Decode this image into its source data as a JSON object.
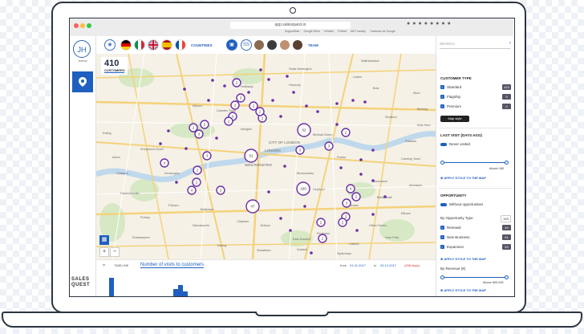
{
  "browser": {
    "address": "app.salesquest.io",
    "bookmarks": [
      "SupportBee",
      "Google Drive",
      "InVision",
      "Pocket",
      "MKT weekly",
      "Traductor de Google"
    ]
  },
  "nav": {
    "avatar_initials": "JH",
    "user_name": "Jeremy",
    "brand_line1": "SALES",
    "brand_line2": "QUEST"
  },
  "topbar": {
    "countries_label": "COUNTRIES",
    "team_label": "TEAM",
    "team_count_badge": "SS",
    "flags": [
      "germany",
      "italy",
      "united-kingdom",
      "spain",
      "france"
    ]
  },
  "map": {
    "customer_count": "410",
    "customer_label": "CUSTOMERS",
    "clusters": [
      {
        "label": "2",
        "kind": "small"
      },
      {
        "label": "3",
        "kind": "small"
      },
      {
        "label": "2",
        "kind": "small"
      },
      {
        "label": "2",
        "kind": "small"
      },
      {
        "label": "3",
        "kind": "small"
      },
      {
        "label": "2",
        "kind": "small"
      },
      {
        "label": "2",
        "kind": "small"
      },
      {
        "label": "2",
        "kind": "small"
      },
      {
        "label": "3",
        "kind": "small"
      },
      {
        "label": "2",
        "kind": "small"
      },
      {
        "label": "2",
        "kind": "small"
      },
      {
        "label": "52",
        "kind": "big"
      },
      {
        "label": "3",
        "kind": "small"
      },
      {
        "label": "2",
        "kind": "small"
      },
      {
        "label": "3",
        "kind": "small"
      },
      {
        "label": "51",
        "kind": "big"
      },
      {
        "label": "4",
        "kind": "small"
      },
      {
        "label": "3",
        "kind": "small"
      },
      {
        "label": "2",
        "kind": "small"
      },
      {
        "label": "2",
        "kind": "small"
      },
      {
        "label": "4",
        "kind": "small"
      },
      {
        "label": "2",
        "kind": "small"
      },
      {
        "label": "100",
        "kind": "big"
      },
      {
        "label": "4",
        "kind": "small"
      },
      {
        "label": "47",
        "kind": "big"
      },
      {
        "label": "2",
        "kind": "small"
      },
      {
        "label": "3",
        "kind": "small"
      },
      {
        "label": "3",
        "kind": "small"
      },
      {
        "label": "2",
        "kind": "small"
      },
      {
        "label": "2",
        "kind": "small"
      },
      {
        "label": "2",
        "kind": "small"
      }
    ],
    "place_labels": [
      "Holloway",
      "Hackney",
      "Bow",
      "Kilburn",
      "Shepherd's Bush",
      "Kensington",
      "Hammersmith",
      "Fulham",
      "Putney",
      "Battersea",
      "Clapham",
      "Brixton",
      "Peckham",
      "Greenwich",
      "Lewisham",
      "Streatham",
      "Catford",
      "Stratford",
      "Plaistow",
      "Woolwich",
      "Eltham",
      "Chinbrook",
      "Wandsworth",
      "Tooting",
      "Acton",
      "Chiswick",
      "Stoke Newington",
      "WESTMINSTER",
      "CITY OF LONDON",
      "LONDON",
      "Ealing",
      "Sydenham",
      "Dulwich",
      "Deptford",
      "Poplar",
      "Canning Town",
      "Barking",
      "Ilford",
      "Leyton",
      "Hither Green",
      "Blackheath",
      "Islington",
      "Camden Town",
      "Bethnal Green",
      "Horn Park",
      "East Dulwich",
      "Balham",
      "Roehampton",
      "Bermondsey",
      "Walthamstow",
      "East Ham"
    ],
    "zoom_in": "+",
    "zoom_out": "−"
  },
  "timeline": {
    "label": "TIMELINE",
    "title": "Number of visits to customers",
    "from_label": "from",
    "from_date": "01.01.2017",
    "to_label": "to",
    "to_date": "25.10.2017",
    "range_days": "(298 days)",
    "bars": [
      0.85,
      0.0,
      0.0,
      0.0,
      0.0,
      0.0,
      0.0,
      0.0,
      0.0,
      0.0,
      0.0,
      0.35,
      0.55,
      0.25
    ]
  },
  "right_panel": {
    "search_placeholder": "SEARCH",
    "customer_type_heading": "CUSTOMER TYPE",
    "customer_types": [
      {
        "label": "Standard",
        "count": "410"
      },
      {
        "label": "Flagship",
        "count": "9"
      },
      {
        "label": "Premium",
        "count": "0"
      }
    ],
    "map_style_label": "Map style",
    "last_visit_heading": "LAST VISIT (DAYS AGO)",
    "never_visited_label": "Never visited",
    "last_visit_value_label": "Above 180",
    "last_visit_level": 1.0,
    "apply_label": "APPLY STYLE TO THE MAP",
    "opportunity_heading": "OPPORTUNITY",
    "without_opportunities_label": "Without opportunities",
    "by_type_label": "By Opportunity Type",
    "by_type_count": "153",
    "opportunity_types": [
      {
        "label": "Renewal",
        "count": "49"
      },
      {
        "label": "New Business",
        "count": "51"
      },
      {
        "label": "Expansion",
        "count": "53"
      }
    ],
    "by_revenue_label": "By Revenue (€)",
    "revenue_value_label": "Above 500,000",
    "revenue_level": 1.0
  },
  "colors": {
    "accent": "#1f5fbf",
    "cluster": "#6b2fa5",
    "map_bg": "#f5f1e6",
    "park": "#d6e8c4",
    "road": "#f4d27a",
    "water": "#bfd8ec"
  }
}
